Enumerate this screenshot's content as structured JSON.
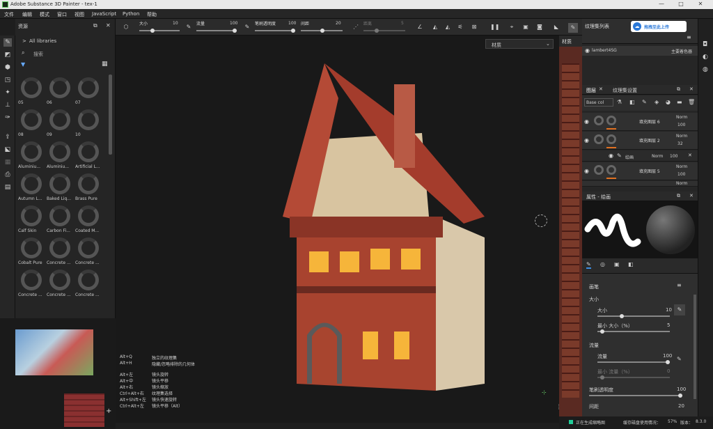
{
  "titlebar": {
    "title": "Adobe Substance 3D Painter - tex-1",
    "minimize": "—",
    "maximize": "□",
    "close": "✕"
  },
  "menu": [
    "文件",
    "编辑",
    "模式",
    "窗口",
    "视图",
    "JavaScript",
    "Python",
    "帮助"
  ],
  "toolbar": {
    "size_label": "大小",
    "size_value": "10",
    "flow_label": "流量",
    "flow_value": "100",
    "opacity_label": "笔刷透明度",
    "opacity_value": "100",
    "spacing_label": "间距",
    "spacing_value": "20",
    "distance_label": "距离",
    "distance_value": "5"
  },
  "assets": {
    "title": "资源",
    "breadcrumb": "All libraries",
    "search_placeholder": "搜索",
    "items": [
      "05",
      "06",
      "07",
      "08",
      "09",
      "10",
      "Aluminiu...",
      "Aluminiu...",
      "Artificial L...",
      "Autumn L...",
      "Baked Liq...",
      "Brass Pure",
      "Calf Skin",
      "Carbon Fi...",
      "Coated M...",
      "Cobalt Pure",
      "Concrete ...",
      "Concrete ...",
      "Concrete ...",
      "Concrete ...",
      "Concrete ..."
    ]
  },
  "viewport": {
    "dropdown": "材质",
    "tab": "材质",
    "shortcuts": [
      {
        "key": "Alt+Q",
        "desc": "独立的纹理集"
      },
      {
        "key": "Alt+H",
        "desc": "隐藏/忽略排除的几何体"
      },
      {
        "key": "Alt+左",
        "desc": "镜头旋转"
      },
      {
        "key": "Alt+中",
        "desc": "镜头平移"
      },
      {
        "key": "Alt+右",
        "desc": "镜头缩放"
      },
      {
        "key": "Ctrl+Alt+右",
        "desc": "纹理集选择"
      },
      {
        "key": "Alt+Shift+左",
        "desc": "镜头快速旋转"
      },
      {
        "key": "Ctrl+Alt+左",
        "desc": "镜头平移（Alt）"
      }
    ]
  },
  "texset_panel": {
    "title": "纹理集列表",
    "upload_btn": "拖拽至此上传",
    "row_name": "lambert4SG",
    "row_shader": "主要着色器"
  },
  "layers_panel": {
    "tab_layers": "图层",
    "tab_settings": "纹理集设置",
    "channel": "Base col",
    "layers": [
      {
        "name": "填充图层 6",
        "blend": "Norm",
        "opacity": "100"
      },
      {
        "name": "填充图层 2",
        "blend": "Norm",
        "opacity": "32"
      },
      {
        "name": "绘画",
        "blend": "Norm",
        "opacity": "100"
      },
      {
        "name": "填充图层 5",
        "blend": "Norm",
        "opacity": "100"
      },
      {
        "name": "",
        "blend": "Norm",
        "opacity": ""
      }
    ]
  },
  "properties": {
    "title": "属性 - 绘画",
    "section_brush": "画笔",
    "group_size": "大小",
    "size": "大小",
    "size_value": "10",
    "min_size": "最小 大小（%）",
    "min_size_value": "5",
    "group_flow": "流量",
    "flow": "流量",
    "flow_value": "100",
    "min_flow": "最小 流量（%）",
    "min_flow_value": "0",
    "brush_opacity": "笔刷透明度",
    "brush_opacity_value": "100",
    "spacing": "间距",
    "spacing_value": "20"
  },
  "status": {
    "text": "正在生成缩略图",
    "cache": "缓存磁盘使用情况：",
    "cache_value": "57%",
    "version": "版本：",
    "version_value": "8.3.0"
  }
}
